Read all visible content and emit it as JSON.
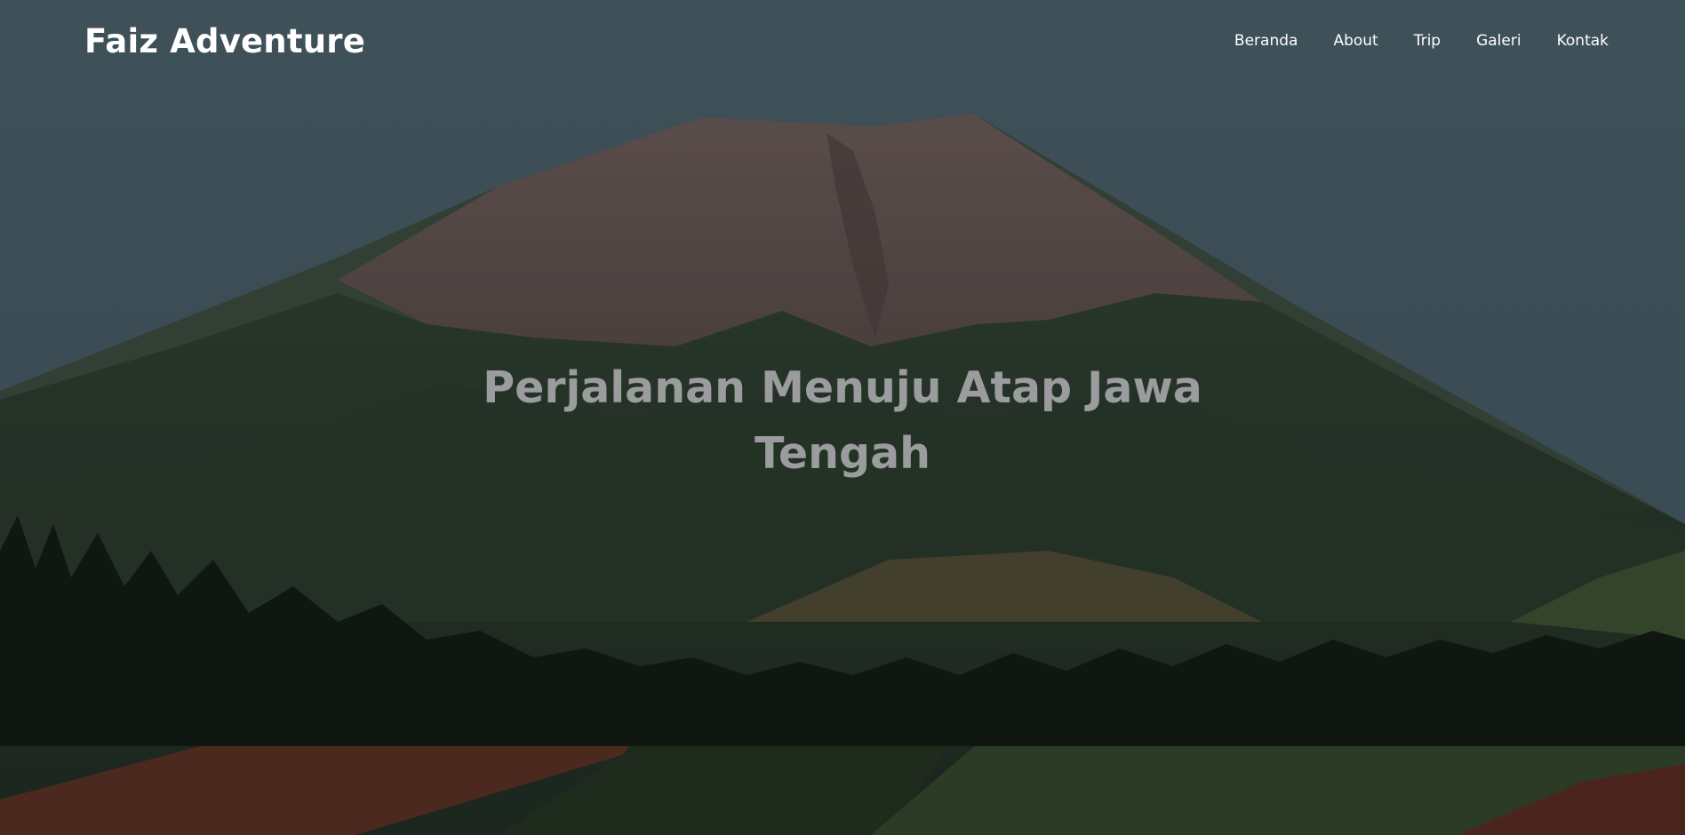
{
  "brand": {
    "name": "Faiz Adventure"
  },
  "nav": {
    "items": [
      {
        "label": "Beranda"
      },
      {
        "label": "About"
      },
      {
        "label": "Trip"
      },
      {
        "label": "Galeri"
      },
      {
        "label": "Kontak"
      }
    ]
  },
  "hero": {
    "headline": "Perjalanan Menuju Atap Jawa Tengah",
    "background": "mountain-landscape-photo"
  },
  "colors": {
    "sky": "#465a63",
    "headline": "#9a9c9d",
    "nav_text": "#ffffff"
  }
}
